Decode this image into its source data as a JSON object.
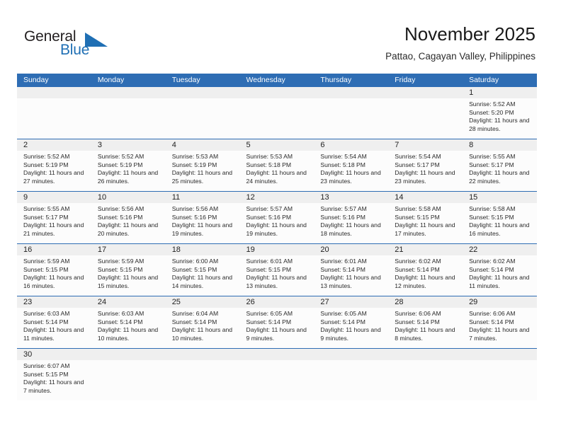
{
  "brand": {
    "name_part1": "General",
    "name_part2": "Blue",
    "flag_icon": "triangle-flag-icon",
    "blue": "#1f6fb4"
  },
  "header": {
    "title": "November 2025",
    "subtitle": "Pattao, Cagayan Valley, Philippines"
  },
  "theme": {
    "header_blue": "#2E6DB4",
    "daynum_band": "#EFEFEF",
    "cell_bg": "#FCFCFC",
    "text": "#222222"
  },
  "calendar": {
    "weekdays": [
      "Sunday",
      "Monday",
      "Tuesday",
      "Wednesday",
      "Thursday",
      "Friday",
      "Saturday"
    ],
    "weeks": [
      [
        {
          "day": "",
          "empty": true
        },
        {
          "day": "",
          "empty": true
        },
        {
          "day": "",
          "empty": true
        },
        {
          "day": "",
          "empty": true
        },
        {
          "day": "",
          "empty": true
        },
        {
          "day": "",
          "empty": true
        },
        {
          "day": "1",
          "sunrise": "Sunrise: 5:52 AM",
          "sunset": "Sunset: 5:20 PM",
          "daylight": "Daylight: 11 hours and 28 minutes."
        }
      ],
      [
        {
          "day": "2",
          "sunrise": "Sunrise: 5:52 AM",
          "sunset": "Sunset: 5:19 PM",
          "daylight": "Daylight: 11 hours and 27 minutes."
        },
        {
          "day": "3",
          "sunrise": "Sunrise: 5:52 AM",
          "sunset": "Sunset: 5:19 PM",
          "daylight": "Daylight: 11 hours and 26 minutes."
        },
        {
          "day": "4",
          "sunrise": "Sunrise: 5:53 AM",
          "sunset": "Sunset: 5:19 PM",
          "daylight": "Daylight: 11 hours and 25 minutes."
        },
        {
          "day": "5",
          "sunrise": "Sunrise: 5:53 AM",
          "sunset": "Sunset: 5:18 PM",
          "daylight": "Daylight: 11 hours and 24 minutes."
        },
        {
          "day": "6",
          "sunrise": "Sunrise: 5:54 AM",
          "sunset": "Sunset: 5:18 PM",
          "daylight": "Daylight: 11 hours and 23 minutes."
        },
        {
          "day": "7",
          "sunrise": "Sunrise: 5:54 AM",
          "sunset": "Sunset: 5:17 PM",
          "daylight": "Daylight: 11 hours and 23 minutes."
        },
        {
          "day": "8",
          "sunrise": "Sunrise: 5:55 AM",
          "sunset": "Sunset: 5:17 PM",
          "daylight": "Daylight: 11 hours and 22 minutes."
        }
      ],
      [
        {
          "day": "9",
          "sunrise": "Sunrise: 5:55 AM",
          "sunset": "Sunset: 5:17 PM",
          "daylight": "Daylight: 11 hours and 21 minutes."
        },
        {
          "day": "10",
          "sunrise": "Sunrise: 5:56 AM",
          "sunset": "Sunset: 5:16 PM",
          "daylight": "Daylight: 11 hours and 20 minutes."
        },
        {
          "day": "11",
          "sunrise": "Sunrise: 5:56 AM",
          "sunset": "Sunset: 5:16 PM",
          "daylight": "Daylight: 11 hours and 19 minutes."
        },
        {
          "day": "12",
          "sunrise": "Sunrise: 5:57 AM",
          "sunset": "Sunset: 5:16 PM",
          "daylight": "Daylight: 11 hours and 19 minutes."
        },
        {
          "day": "13",
          "sunrise": "Sunrise: 5:57 AM",
          "sunset": "Sunset: 5:16 PM",
          "daylight": "Daylight: 11 hours and 18 minutes."
        },
        {
          "day": "14",
          "sunrise": "Sunrise: 5:58 AM",
          "sunset": "Sunset: 5:15 PM",
          "daylight": "Daylight: 11 hours and 17 minutes."
        },
        {
          "day": "15",
          "sunrise": "Sunrise: 5:58 AM",
          "sunset": "Sunset: 5:15 PM",
          "daylight": "Daylight: 11 hours and 16 minutes."
        }
      ],
      [
        {
          "day": "16",
          "sunrise": "Sunrise: 5:59 AM",
          "sunset": "Sunset: 5:15 PM",
          "daylight": "Daylight: 11 hours and 16 minutes."
        },
        {
          "day": "17",
          "sunrise": "Sunrise: 5:59 AM",
          "sunset": "Sunset: 5:15 PM",
          "daylight": "Daylight: 11 hours and 15 minutes."
        },
        {
          "day": "18",
          "sunrise": "Sunrise: 6:00 AM",
          "sunset": "Sunset: 5:15 PM",
          "daylight": "Daylight: 11 hours and 14 minutes."
        },
        {
          "day": "19",
          "sunrise": "Sunrise: 6:01 AM",
          "sunset": "Sunset: 5:15 PM",
          "daylight": "Daylight: 11 hours and 13 minutes."
        },
        {
          "day": "20",
          "sunrise": "Sunrise: 6:01 AM",
          "sunset": "Sunset: 5:14 PM",
          "daylight": "Daylight: 11 hours and 13 minutes."
        },
        {
          "day": "21",
          "sunrise": "Sunrise: 6:02 AM",
          "sunset": "Sunset: 5:14 PM",
          "daylight": "Daylight: 11 hours and 12 minutes."
        },
        {
          "day": "22",
          "sunrise": "Sunrise: 6:02 AM",
          "sunset": "Sunset: 5:14 PM",
          "daylight": "Daylight: 11 hours and 11 minutes."
        }
      ],
      [
        {
          "day": "23",
          "sunrise": "Sunrise: 6:03 AM",
          "sunset": "Sunset: 5:14 PM",
          "daylight": "Daylight: 11 hours and 11 minutes."
        },
        {
          "day": "24",
          "sunrise": "Sunrise: 6:03 AM",
          "sunset": "Sunset: 5:14 PM",
          "daylight": "Daylight: 11 hours and 10 minutes."
        },
        {
          "day": "25",
          "sunrise": "Sunrise: 6:04 AM",
          "sunset": "Sunset: 5:14 PM",
          "daylight": "Daylight: 11 hours and 10 minutes."
        },
        {
          "day": "26",
          "sunrise": "Sunrise: 6:05 AM",
          "sunset": "Sunset: 5:14 PM",
          "daylight": "Daylight: 11 hours and 9 minutes."
        },
        {
          "day": "27",
          "sunrise": "Sunrise: 6:05 AM",
          "sunset": "Sunset: 5:14 PM",
          "daylight": "Daylight: 11 hours and 9 minutes."
        },
        {
          "day": "28",
          "sunrise": "Sunrise: 6:06 AM",
          "sunset": "Sunset: 5:14 PM",
          "daylight": "Daylight: 11 hours and 8 minutes."
        },
        {
          "day": "29",
          "sunrise": "Sunrise: 6:06 AM",
          "sunset": "Sunset: 5:14 PM",
          "daylight": "Daylight: 11 hours and 7 minutes."
        }
      ],
      [
        {
          "day": "30",
          "sunrise": "Sunrise: 6:07 AM",
          "sunset": "Sunset: 5:15 PM",
          "daylight": "Daylight: 11 hours and 7 minutes."
        },
        {
          "day": "",
          "empty": true
        },
        {
          "day": "",
          "empty": true
        },
        {
          "day": "",
          "empty": true
        },
        {
          "day": "",
          "empty": true
        },
        {
          "day": "",
          "empty": true
        },
        {
          "day": "",
          "empty": true
        }
      ]
    ]
  }
}
